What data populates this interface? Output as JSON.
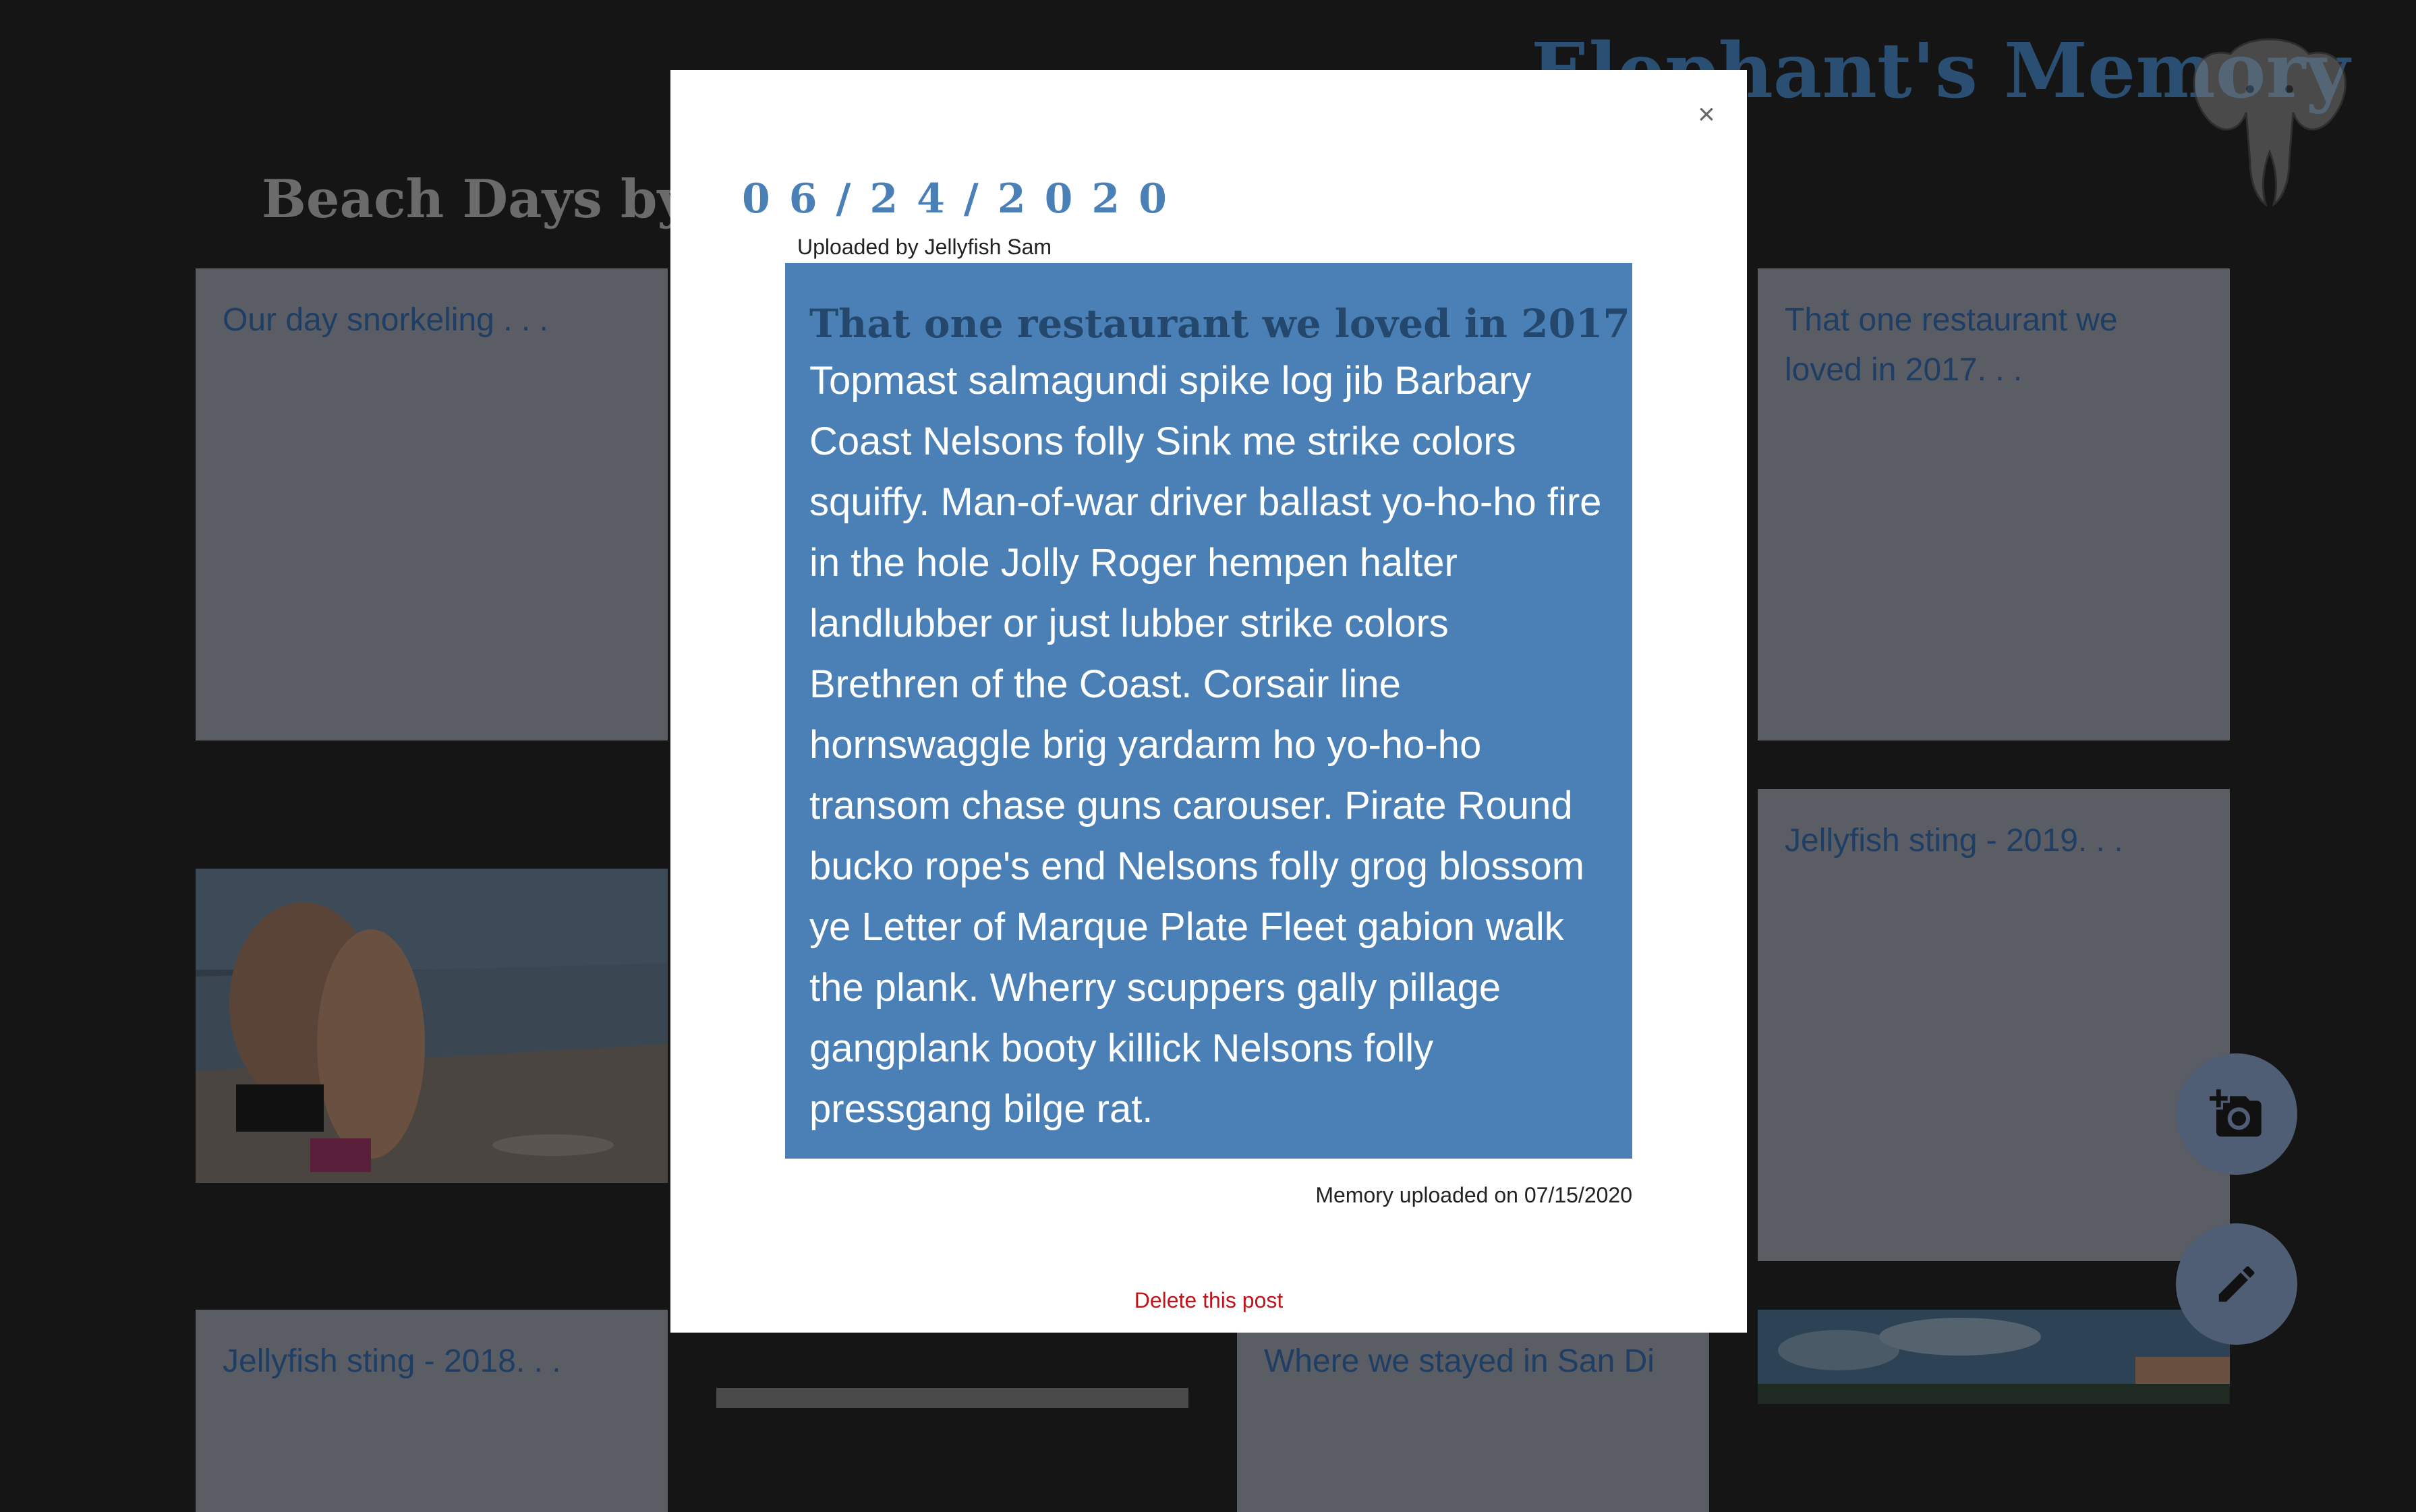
{
  "site": {
    "title": "Elephant's Memory"
  },
  "album": {
    "heading": "Beach Days by Gu"
  },
  "cards": {
    "snorkeling": "Our day snorkeling . . .",
    "restaurant": "That one restaurant we loved in 2017. . .",
    "jellyfish_2019": "Jellyfish sting - 2019. . .",
    "jellyfish_2018": "Jellyfish sting - 2018. . .",
    "san_diego": "Where we stayed in San Di"
  },
  "modal": {
    "close_symbol": "×",
    "event_date": "06/24/2020",
    "uploaded_by": "Uploaded by Jellyfish Sam",
    "story_title": "That one restaurant we loved in 2017",
    "story_body": "Topmast salmagundi spike log jib Barbary Coast Nelsons folly Sink me strike colors squiffy. Man-of-war driver ballast yo-ho-ho fire in the hole Jolly Roger hempen halter landlubber or just lubber strike colors Brethren of the Coast. Corsair line hornswaggle brig yardarm ho yo-ho-ho transom chase guns carouser. Pirate Round bucko rope's end Nelsons folly grog blossom ye Letter of Marque Plate Fleet gabion walk the plank. Wherry scuppers gally pillage gangplank booty killick Nelsons folly pressgang bilge rat.",
    "uploaded_on": "Memory uploaded on 07/15/2020",
    "delete_label": "Delete this post"
  },
  "fabs": {
    "add_photo_icon": "add-photo-icon",
    "edit_icon": "edit-pencil-icon"
  },
  "colors": {
    "accent": "#4a80b5",
    "title_dark": "#24486d",
    "delete": "#c0141a",
    "page_bg": "#151515"
  }
}
